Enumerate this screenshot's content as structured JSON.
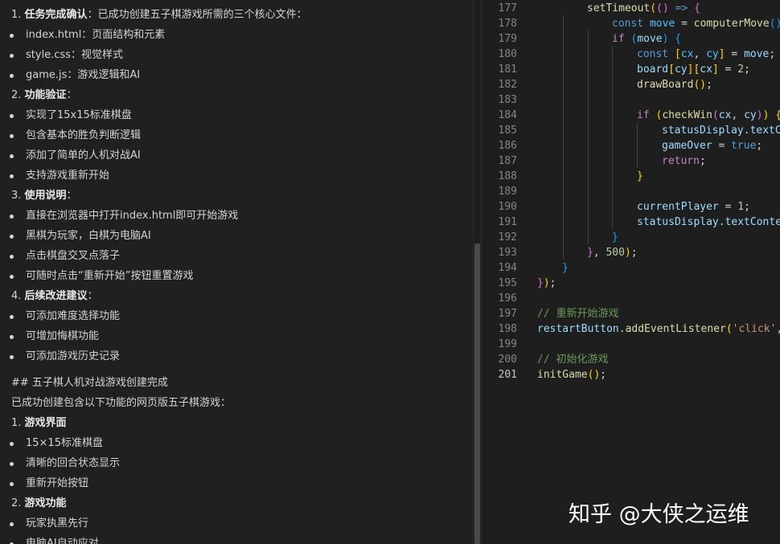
{
  "chat": {
    "task_heading": "1. ",
    "task_title": "任务完成确认",
    "task_text": "：已成功创建五子棋游戏所需的三个核心文件：",
    "files": [
      "index.html：页面结构和元素",
      "style.css：视觉样式",
      "game.js：游戏逻辑和AI"
    ],
    "verify_heading": "2. ",
    "verify_title": "功能验证",
    "verify_colon": "：",
    "verify_items": [
      "实现了15x15标准棋盘",
      "包含基本的胜负判断逻辑",
      "添加了简单的人机对战AI",
      "支持游戏重新开始"
    ],
    "usage_heading": "3. ",
    "usage_title": "使用说明",
    "usage_colon": "：",
    "usage_items": [
      "直接在浏览器中打开index.html即可开始游戏",
      "黑棋为玩家，白棋为电脑AI",
      "点击棋盘交叉点落子",
      "可随时点击“重新开始”按钮重置游戏"
    ],
    "improve_heading": "4. ",
    "improve_title": "后续改进建议",
    "improve_colon": "：",
    "improve_items": [
      "可添加难度选择功能",
      "可增加悔棋功能",
      "可添加游戏历史记录"
    ],
    "summary_heading": "## 五子棋人机对战游戏创建完成",
    "summary_text": "已成功创建包含以下功能的网页版五子棋游戏：",
    "ui_heading": "1. ",
    "ui_title": "游戏界面",
    "ui_items": [
      "15×15标准棋盘",
      "清晰的回合状态显示",
      "重新开始按钮"
    ],
    "func_heading": "2. ",
    "func_title": "游戏功能",
    "func_items": [
      "玩家执黑先行",
      "电脑AI自动应对"
    ]
  },
  "editor": {
    "line_numbers": [
      "177",
      "178",
      "179",
      "180",
      "181",
      "182",
      "183",
      "184",
      "185",
      "186",
      "187",
      "188",
      "189",
      "190",
      "191",
      "192",
      "193",
      "194",
      "195",
      "196",
      "197",
      "198",
      "199",
      "200",
      "201"
    ],
    "current_line": "201",
    "lines": [
      [
        [
          "fn",
          "setTimeout"
        ],
        [
          "br1",
          "("
        ],
        [
          "br2",
          "("
        ],
        [
          "br2",
          ")"
        ],
        [
          "kw",
          " =>"
        ],
        [
          "br2",
          " {"
        ]
      ],
      [
        [
          "kw",
          "const"
        ],
        [
          "cst",
          " move"
        ],
        [
          "plain",
          " = "
        ],
        [
          "fn",
          "computerMove"
        ],
        [
          "br3",
          "()"
        ],
        [
          "plain",
          ";"
        ]
      ],
      [
        [
          "ctl",
          "if"
        ],
        [
          "plain",
          " "
        ],
        [
          "br3",
          "("
        ],
        [
          "var",
          "move"
        ],
        [
          "br3",
          ")"
        ],
        [
          "br3",
          " {"
        ]
      ],
      [
        [
          "kw",
          "const"
        ],
        [
          "plain",
          " "
        ],
        [
          "br1",
          "["
        ],
        [
          "cst",
          "cx"
        ],
        [
          "plain",
          ", "
        ],
        [
          "cst",
          "cy"
        ],
        [
          "br1",
          "]"
        ],
        [
          "plain",
          " = "
        ],
        [
          "var",
          "move"
        ],
        [
          "plain",
          ";"
        ]
      ],
      [
        [
          "var",
          "board"
        ],
        [
          "br1",
          "["
        ],
        [
          "var",
          "cy"
        ],
        [
          "br1",
          "]"
        ],
        [
          "br1",
          "["
        ],
        [
          "var",
          "cx"
        ],
        [
          "br1",
          "]"
        ],
        [
          "plain",
          " = "
        ],
        [
          "num",
          "2"
        ],
        [
          "plain",
          ";"
        ]
      ],
      [
        [
          "fn",
          "drawBoard"
        ],
        [
          "br1",
          "()"
        ],
        [
          "plain",
          ";"
        ]
      ],
      [
        [
          "plain",
          ""
        ]
      ],
      [
        [
          "ctl",
          "if"
        ],
        [
          "plain",
          " "
        ],
        [
          "br1",
          "("
        ],
        [
          "fn",
          "checkWin"
        ],
        [
          "br2",
          "("
        ],
        [
          "var",
          "cx"
        ],
        [
          "plain",
          ", "
        ],
        [
          "var",
          "cy"
        ],
        [
          "br2",
          ")"
        ],
        [
          "br1",
          ")"
        ],
        [
          "br1",
          " {"
        ]
      ],
      [
        [
          "var",
          "statusDisplay"
        ],
        [
          "plain",
          "."
        ],
        [
          "var",
          "textCo"
        ]
      ],
      [
        [
          "var",
          "gameOver"
        ],
        [
          "plain",
          " = "
        ],
        [
          "kw",
          "true"
        ],
        [
          "plain",
          ";"
        ]
      ],
      [
        [
          "ctl",
          "return"
        ],
        [
          "plain",
          ";"
        ]
      ],
      [
        [
          "br1",
          "}"
        ]
      ],
      [
        [
          "plain",
          ""
        ]
      ],
      [
        [
          "var",
          "currentPlayer"
        ],
        [
          "plain",
          " = "
        ],
        [
          "num",
          "1"
        ],
        [
          "plain",
          ";"
        ]
      ],
      [
        [
          "var",
          "statusDisplay"
        ],
        [
          "plain",
          "."
        ],
        [
          "var",
          "textConter"
        ]
      ],
      [
        [
          "br3",
          "}"
        ]
      ],
      [
        [
          "br2",
          "}"
        ],
        [
          "plain",
          ", "
        ],
        [
          "num",
          "500"
        ],
        [
          "br1",
          ")"
        ],
        [
          "plain",
          ";"
        ]
      ],
      [
        [
          "br3",
          "}"
        ]
      ],
      [
        [
          "br2",
          "}"
        ],
        [
          "br1",
          ")"
        ],
        [
          "plain",
          ";"
        ]
      ],
      [
        [
          "plain",
          ""
        ]
      ],
      [
        [
          "cm",
          "// 重新开始游戏"
        ]
      ],
      [
        [
          "var",
          "restartButton"
        ],
        [
          "plain",
          "."
        ],
        [
          "fn",
          "addEventListener"
        ],
        [
          "br1",
          "("
        ],
        [
          "str",
          "'click'"
        ],
        [
          "plain",
          ","
        ]
      ],
      [
        [
          "plain",
          ""
        ]
      ],
      [
        [
          "cm",
          "// 初始化游戏"
        ]
      ],
      [
        [
          "fn",
          "initGame"
        ],
        [
          "br1",
          "()"
        ],
        [
          "plain",
          ";"
        ]
      ]
    ]
  },
  "watermark": "知乎 @大侠之运维"
}
